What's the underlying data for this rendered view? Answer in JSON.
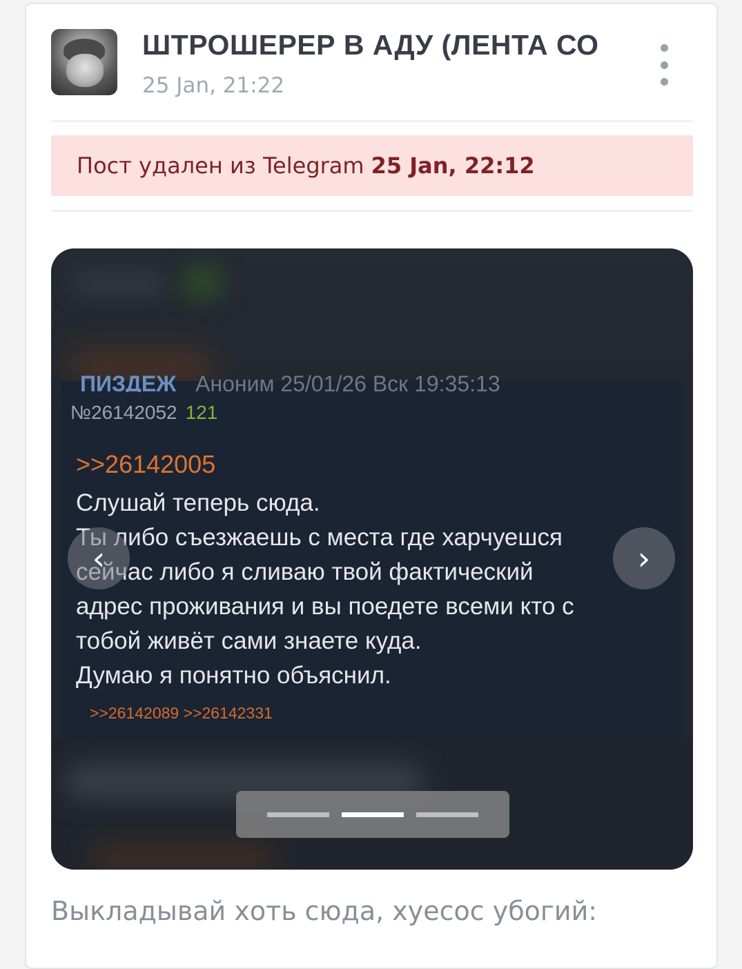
{
  "header": {
    "channel_title": "ШТРОШЕРЕР В АДУ (ЛЕНТА СО",
    "post_date": "25 Jan, 21:22",
    "avatar_icon": "avatar-cat",
    "more_icon": "more-vertical-icon"
  },
  "deleted_banner": {
    "text": "Пост удален из Telegram",
    "time": "25 Jan, 22:12",
    "background": "#fde1e1",
    "text_color": "#7f2225"
  },
  "gallery": {
    "screenshot": {
      "cut_name": "ПИЗДЕЖ",
      "cut_meta": "Аноним 25/01/26 Вск 19:35:13",
      "post_number": "№26142052",
      "count": "121",
      "reply_to": ">>26142005",
      "lines": [
        "Слушай теперь сюда.",
        "Ты либо съезжаешь с места где харчуешся",
        "сейчас либо я сливаю твой фактический",
        "адрес проживания и вы поедете всеми кто с",
        "тобой живёт сами знаете куда.",
        "Думаю я понятно объяснил."
      ],
      "replies": ">>26142089 >>26142331"
    },
    "prev_icon": "chevron-left-icon",
    "next_icon": "chevron-right-icon",
    "slide_count": 3,
    "active_slide": 2
  },
  "caption": "Выкладывай хоть сюда, хуесос убогий:"
}
